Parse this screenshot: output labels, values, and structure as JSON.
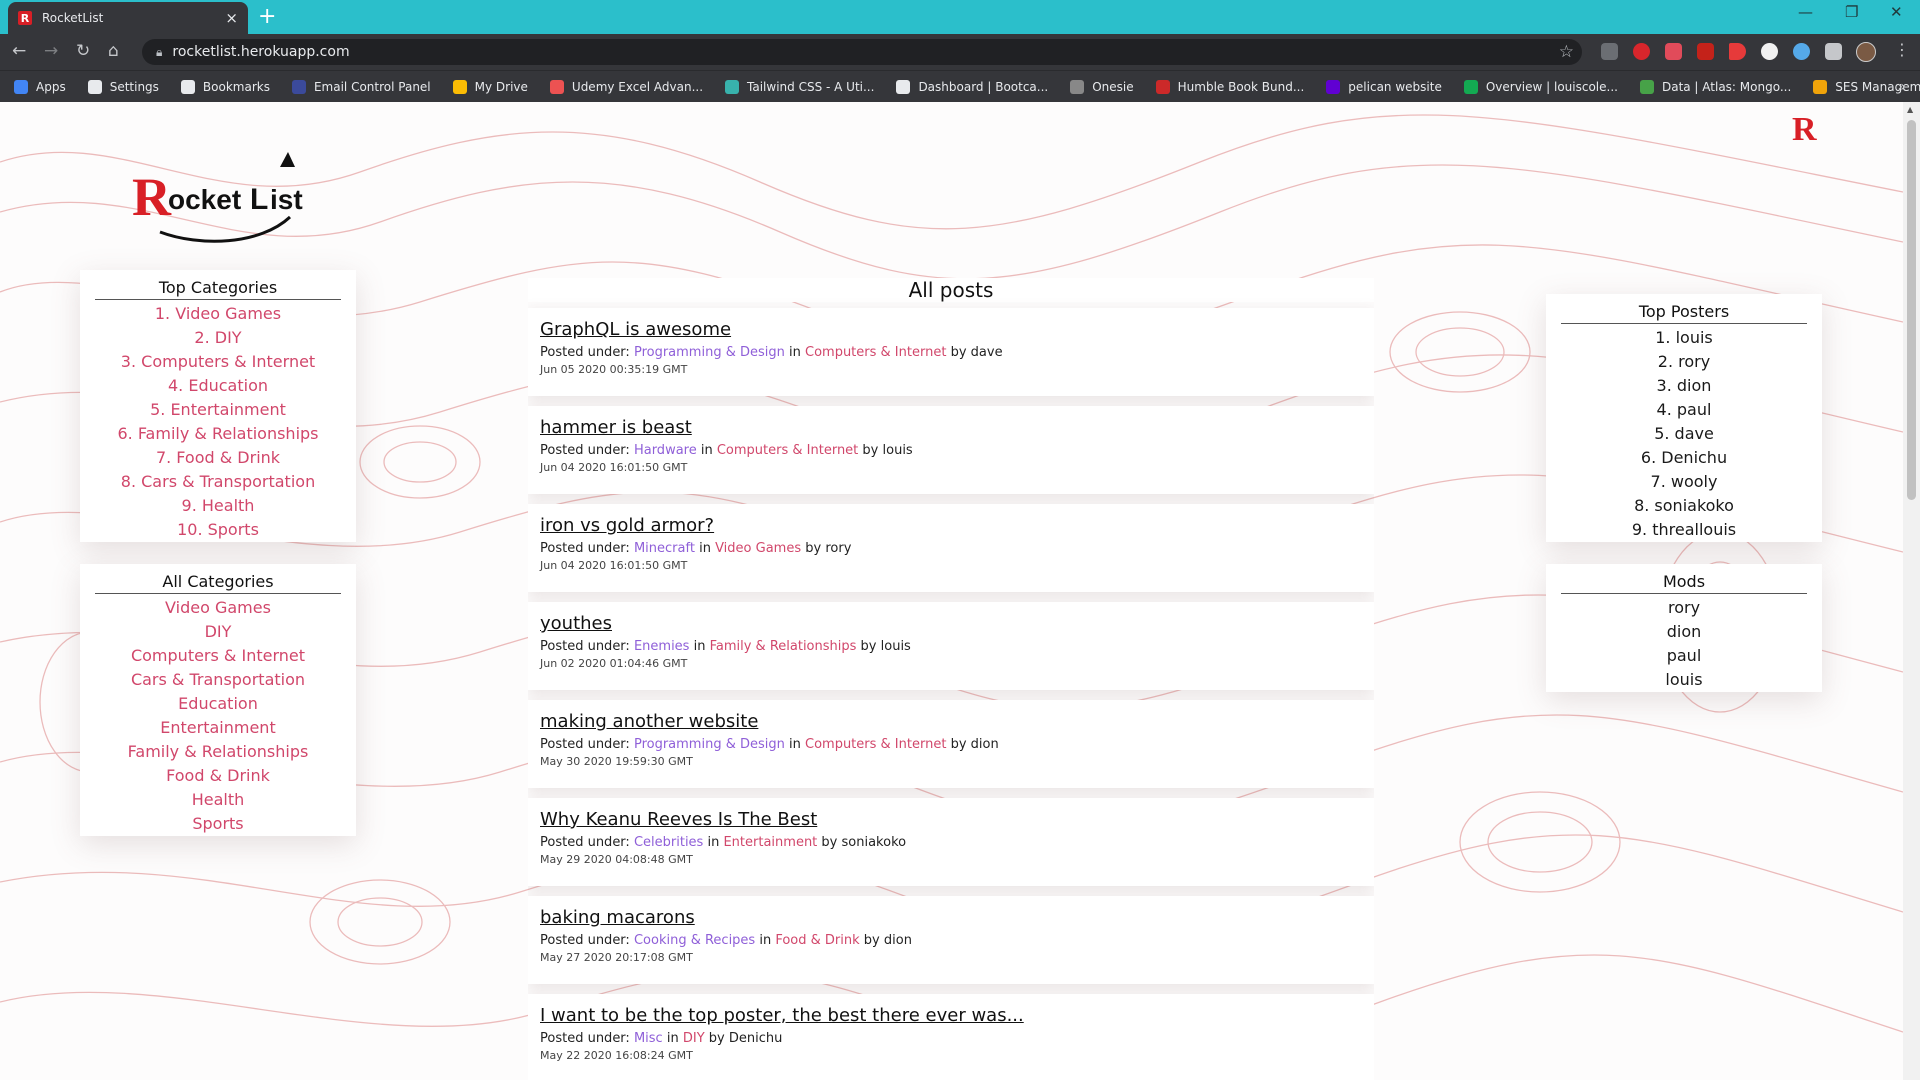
{
  "browser": {
    "tab_title": "RocketList",
    "favicon_letter": "R",
    "url": "rocketlist.herokuapp.com",
    "bookmarks": [
      {
        "label": "Apps",
        "icon": "apps-grid-icon",
        "color": "#4285f4"
      },
      {
        "label": "Settings",
        "icon": "gear-icon",
        "color": "#e8eaed"
      },
      {
        "label": "Bookmarks",
        "icon": "star-icon",
        "color": "#e8eaed"
      },
      {
        "label": "Email Control Panel",
        "icon": "panel-icon",
        "color": "#3b4a9b"
      },
      {
        "label": "My Drive",
        "icon": "drive-icon",
        "color": "#fbbc04"
      },
      {
        "label": "Udemy Excel Advan...",
        "icon": "udemy-icon",
        "color": "#ec5252"
      },
      {
        "label": "Tailwind CSS - A Uti...",
        "icon": "tailwind-icon",
        "color": "#38b2ac"
      },
      {
        "label": "Dashboard | Bootca...",
        "icon": "github-icon",
        "color": "#e8eaed"
      },
      {
        "label": "Onesie",
        "icon": "onesie-icon",
        "color": "#888888"
      },
      {
        "label": "Humble Book Bund...",
        "icon": "humble-icon",
        "color": "#cc2929"
      },
      {
        "label": "pelican website",
        "icon": "yahoo-icon",
        "color": "#6001d2"
      },
      {
        "label": "Overview | louiscole...",
        "icon": "diamond-icon",
        "color": "#13aa52"
      },
      {
        "label": "Data | Atlas: Mongo...",
        "icon": "mongo-leaf-icon",
        "color": "#47a248"
      },
      {
        "label": "SES Management C...",
        "icon": "aws-icon",
        "color": "#f0a30a"
      }
    ]
  },
  "site": {
    "logo_text": "RocketList",
    "corner_logo": "R",
    "top_categories": {
      "title": "Top Categories",
      "items": [
        "1. Video Games",
        "2. DIY",
        "3. Computers & Internet",
        "4. Education",
        "5. Entertainment",
        "6. Family & Relationships",
        "7. Food & Drink",
        "8. Cars & Transportation",
        "9. Health",
        "10. Sports"
      ]
    },
    "all_categories": {
      "title": "All Categories",
      "items": [
        "Video Games",
        "DIY",
        "Computers & Internet",
        "Cars & Transportation",
        "Education",
        "Entertainment",
        "Family & Relationships",
        "Food & Drink",
        "Health",
        "Sports"
      ]
    },
    "top_posters": {
      "title": "Top Posters",
      "items": [
        "1. louis",
        "2. rory",
        "3. dion",
        "4. paul",
        "5. dave",
        "6. Denichu",
        "7. wooly",
        "8. soniakoko",
        "9. threallouis"
      ]
    },
    "mods": {
      "title": "Mods",
      "items": [
        "rory",
        "dion",
        "paul",
        "louis"
      ]
    },
    "feed": {
      "title": "All posts",
      "posted_under_label": "Posted under:",
      "in_label": "in",
      "by_label": "by",
      "posts": [
        {
          "title": "GraphQL is awesome",
          "subcategory": "Programming & Design",
          "category": "Computers & Internet",
          "author": "dave",
          "date": "Jun 05 2020 00:35:19 GMT"
        },
        {
          "title": "hammer is beast",
          "subcategory": "Hardware",
          "category": "Computers & Internet",
          "author": "louis",
          "date": "Jun 04 2020 16:01:50 GMT"
        },
        {
          "title": "iron vs gold armor?",
          "subcategory": "Minecraft",
          "category": "Video Games",
          "author": "rory",
          "date": "Jun 04 2020 16:01:50 GMT"
        },
        {
          "title": "youthes",
          "subcategory": "Enemies",
          "category": "Family & Relationships",
          "author": "louis",
          "date": "Jun 02 2020 01:04:46 GMT"
        },
        {
          "title": "making another website",
          "subcategory": "Programming & Design",
          "category": "Computers & Internet",
          "author": "dion",
          "date": "May 30 2020 19:59:30 GMT"
        },
        {
          "title": "Why Keanu Reeves Is The Best",
          "subcategory": "Celebrities",
          "category": "Entertainment",
          "author": "soniakoko",
          "date": "May 29 2020 04:08:48 GMT"
        },
        {
          "title": "baking macarons",
          "subcategory": "Cooking & Recipes",
          "category": "Food & Drink",
          "author": "dion",
          "date": "May 27 2020 20:17:08 GMT"
        },
        {
          "title": "I want to be the top poster, the best there ever was...",
          "subcategory": "Misc",
          "category": "DIY",
          "author": "Denichu",
          "date": "May 22 2020 16:08:24 GMT"
        }
      ]
    }
  },
  "colors": {
    "chrome_tabstrip": "#2bbfcb",
    "chrome_toolbar": "#35363a",
    "accent_pink": "#d1476b",
    "accent_purple": "#8f5fd8",
    "brand_red": "#d81f26"
  }
}
